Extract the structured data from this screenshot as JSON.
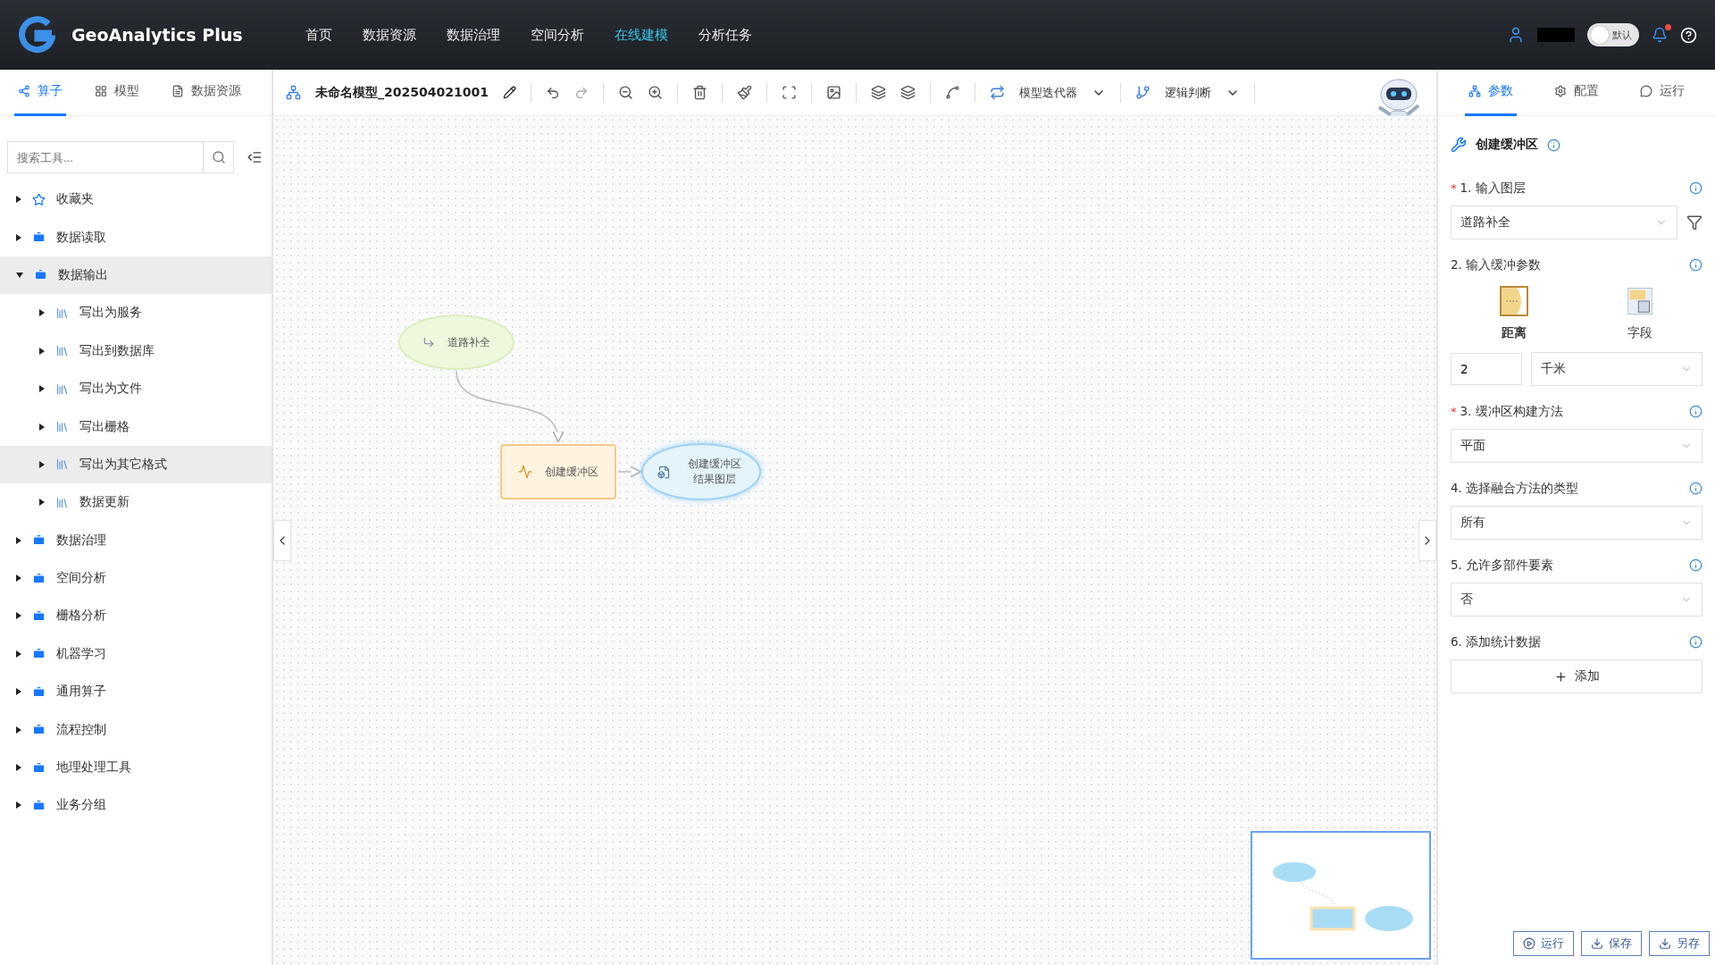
{
  "header": {
    "brand": "GeoAnalytics Plus",
    "nav": [
      {
        "label": "首页",
        "selected": false
      },
      {
        "label": "数据资源",
        "selected": false
      },
      {
        "label": "数据治理",
        "selected": false
      },
      {
        "label": "空间分析",
        "selected": false
      },
      {
        "label": "在线建模",
        "selected": true
      },
      {
        "label": "分析任务",
        "selected": false
      }
    ],
    "theme_toggle": {
      "label": "默认",
      "on": false
    },
    "notification": true
  },
  "left_tabs": [
    {
      "label": "算子",
      "selected": true
    },
    {
      "label": "模型",
      "selected": false
    },
    {
      "label": "数据资源",
      "selected": false
    }
  ],
  "search": {
    "placeholder": "搜索工具..."
  },
  "tree": [
    {
      "label": "收藏夹",
      "kind": "favorite",
      "expanded": false,
      "highlighted": false
    },
    {
      "label": "数据读取",
      "kind": "group",
      "expanded": false,
      "highlighted": false
    },
    {
      "label": "数据输出",
      "kind": "group",
      "expanded": true,
      "highlighted": true,
      "children": [
        {
          "label": "写出为服务",
          "kind": "tool",
          "expanded": false,
          "highlighted": false
        },
        {
          "label": "写出到数据库",
          "kind": "tool",
          "expanded": false,
          "highlighted": false
        },
        {
          "label": "写出为文件",
          "kind": "tool",
          "expanded": false,
          "highlighted": false
        },
        {
          "label": "写出栅格",
          "kind": "tool",
          "expanded": false,
          "highlighted": false
        },
        {
          "label": "写出为其它格式",
          "kind": "tool",
          "expanded": false,
          "highlighted": true
        },
        {
          "label": "数据更新",
          "kind": "tool",
          "expanded": false,
          "highlighted": false
        }
      ]
    },
    {
      "label": "数据治理",
      "kind": "group",
      "expanded": false,
      "highlighted": false
    },
    {
      "label": "空间分析",
      "kind": "group",
      "expanded": false,
      "highlighted": false
    },
    {
      "label": "栅格分析",
      "kind": "group",
      "expanded": false,
      "highlighted": false
    },
    {
      "label": "机器学习",
      "kind": "group",
      "expanded": false,
      "highlighted": false
    },
    {
      "label": "通用算子",
      "kind": "group",
      "expanded": false,
      "highlighted": false
    },
    {
      "label": "流程控制",
      "kind": "group",
      "expanded": false,
      "highlighted": false
    },
    {
      "label": "地理处理工具",
      "kind": "group",
      "expanded": false,
      "highlighted": false
    },
    {
      "label": "业务分组",
      "kind": "group",
      "expanded": false,
      "highlighted": false
    }
  ],
  "toolbar": {
    "model_name": "未命名模型_202504021001",
    "iterator": "模型迭代器",
    "logic": "逻辑判断"
  },
  "canvas": {
    "nodes": [
      {
        "kind": "input",
        "label": "道路补全"
      },
      {
        "kind": "tool",
        "label": "创建缓冲区"
      },
      {
        "kind": "output",
        "label": "创建缓冲区结果图层"
      }
    ]
  },
  "right_tabs": [
    {
      "label": "参数",
      "selected": true
    },
    {
      "label": "配置",
      "selected": false
    },
    {
      "label": "运行",
      "selected": false
    }
  ],
  "panel": {
    "title": "创建缓冲区",
    "params": [
      {
        "kind": "select",
        "label": "1. 输入图层",
        "required_mark": "*",
        "value": "道路补全",
        "filter": true
      },
      {
        "kind": "buffer",
        "label": "2. 输入缓冲参数",
        "options": [
          {
            "label": "距离",
            "selected": true
          },
          {
            "label": "字段",
            "selected": false
          }
        ],
        "distance": "2",
        "unit": "千米"
      },
      {
        "kind": "select",
        "label": "3. 缓冲区构建方法",
        "required_mark": "*",
        "value": "平面",
        "filter": false
      },
      {
        "kind": "select",
        "label": "4. 选择融合方法的类型",
        "value": "所有",
        "filter": false
      },
      {
        "kind": "select",
        "label": "5. 允许多部件要素",
        "value": "否",
        "filter": false
      },
      {
        "kind": "add",
        "label": "6. 添加统计数据",
        "action": "添加"
      }
    ]
  },
  "footer_buttons": [
    "运行",
    "保存",
    "另存"
  ]
}
